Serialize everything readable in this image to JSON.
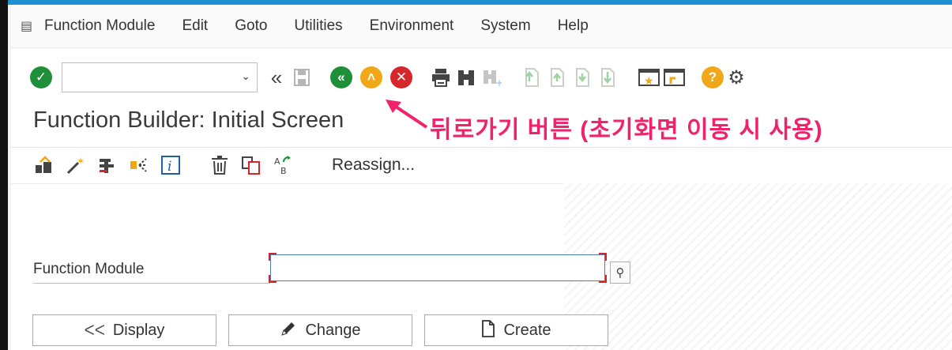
{
  "menu": {
    "items": [
      "Function Module",
      "Edit",
      "Goto",
      "Utilities",
      "Environment",
      "System",
      "Help"
    ]
  },
  "toolbar": {
    "command_field_value": "",
    "icons": [
      "enter-icon",
      "back-icon",
      "exit-icon",
      "cancel-icon",
      "print-icon",
      "find-icon",
      "find-next-icon",
      "first-page-icon",
      "previous-page-icon",
      "next-page-icon",
      "last-page-icon",
      "create-session-icon",
      "shortcut-icon",
      "help-icon",
      "settings-icon"
    ]
  },
  "title": "Function Builder: Initial Screen",
  "annotation": "뒤로가기 버튼 (초기화면 이동 시 사용)",
  "app_toolbar": {
    "reassign_label": "Reassign..."
  },
  "form": {
    "function_module_label": "Function Module",
    "function_module_value": ""
  },
  "buttons": {
    "display": "Display",
    "change": "Change",
    "create": "Create"
  },
  "colors": {
    "accent": "#1e8fcf",
    "annotation": "#f0226a",
    "ok_green": "#1f8f3a",
    "back_orange": "#f0a818",
    "cancel_red": "#d7262a"
  }
}
